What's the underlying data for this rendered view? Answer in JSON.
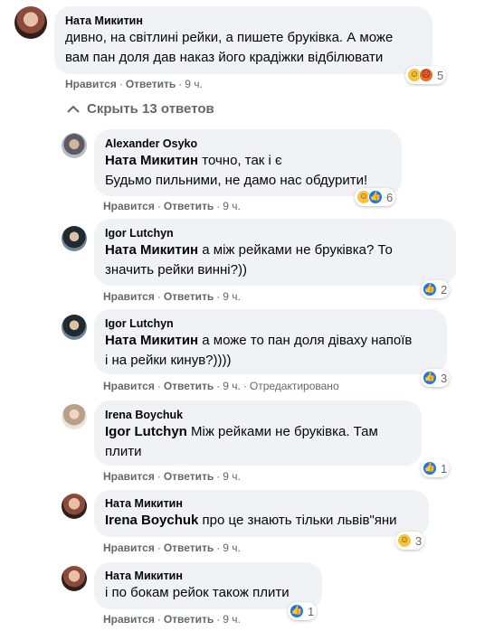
{
  "comments": [
    {
      "author": "Ната Микитин",
      "text_line1": "дивно, на світлині рейки, а пишете бруківка. А може",
      "text_line2": "вам пан доля дав наказ його крадіжки відбілювати",
      "reactions": [
        "haha-icon",
        "angry-icon"
      ],
      "reaction_count": "5",
      "like": "Нравится",
      "reply": "Ответить",
      "time": "9 ч."
    }
  ],
  "toggle_replies": "Скрыть 13 ответов",
  "replies": [
    {
      "author": "Alexander Osyko",
      "mention": "Ната Микитин",
      "text_line1": " точно, так і є",
      "text_line2": "Будьмо пильними, не дамо нас обдурити!",
      "reactions": [
        "haha-icon",
        "like-icon"
      ],
      "reaction_count": "6",
      "like": "Нравится",
      "reply": "Ответить",
      "time": "9 ч."
    },
    {
      "author": "Igor Lutchyn",
      "mention": "Ната Микитин",
      "text_line1": " а між рейками не бруківка? То",
      "text_line2": "значить рейки винні?))",
      "reactions": [
        "like-icon"
      ],
      "reaction_count": "2",
      "like": "Нравится",
      "reply": "Ответить",
      "time": "9 ч."
    },
    {
      "author": "Igor Lutchyn",
      "mention": "Ната Микитин",
      "text_line1": " а може то пан доля діваху напоїв",
      "text_line2": "і на рейки кинув?))))",
      "reactions": [
        "like-icon"
      ],
      "reaction_count": "3",
      "like": "Нравится",
      "reply": "Ответить",
      "time": "9 ч.",
      "edited": "Отредактировано"
    },
    {
      "author": "Irena Boychuk",
      "mention": "Igor Lutchyn",
      "text_line1": " Між рейками не бруківка. Там",
      "text_line2": "плити",
      "reactions": [
        "like-icon"
      ],
      "reaction_count": "1",
      "like": "Нравится",
      "reply": "Ответить",
      "time": "9 ч."
    },
    {
      "author": "Ната Микитин",
      "mention": "Irena Boychuk",
      "text_line1": " про це знають тільки львів\"яни",
      "reactions": [
        "haha-icon"
      ],
      "reaction_count": "3",
      "like": "Нравится",
      "reply": "Ответить",
      "time": "9 ч."
    },
    {
      "author": "Ната Микитин",
      "text_line1": "і по бокам рейок також плити",
      "reactions": [
        "like-icon"
      ],
      "reaction_count": "1",
      "like": "Нравится",
      "reply": "Ответить",
      "time": "9 ч."
    }
  ]
}
